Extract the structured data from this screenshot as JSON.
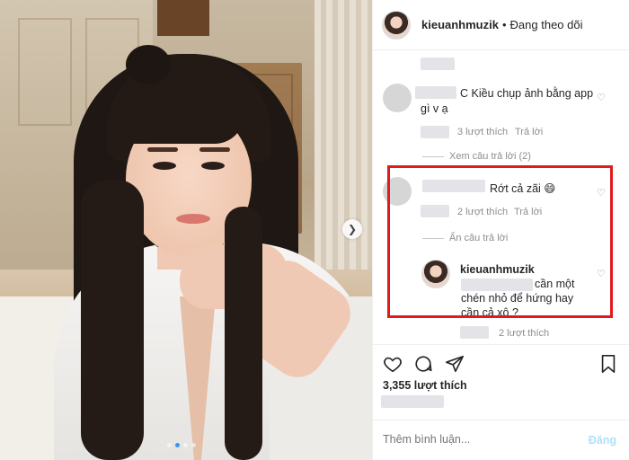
{
  "header": {
    "username": "kieuanhmuzik",
    "separator": "•",
    "follow_status": "Đang theo dõi"
  },
  "comments": [
    {
      "text_suffix": "C Kiều chụp ảnh bằng app",
      "text_line2": "gì v ạ",
      "likes": "3 lượt thích",
      "reply": "Trả lời",
      "view_replies": "Xem câu trả lời (2)"
    },
    {
      "text": "Rớt cả zãi 😄",
      "likes": "2 lượt thích",
      "reply": "Trả lời",
      "hide_replies": "Ẩn câu trả lời",
      "reply_item": {
        "username": "kieuanhmuzik",
        "text_line1": "cần một",
        "text_line2": "chén nhỏ để hứng hay",
        "text_line3": "cần cả xô ?",
        "likes": "2 lượt thích"
      }
    }
  ],
  "post": {
    "like_count": "3,355 lượt thích",
    "comment_placeholder": "Thêm bình luận...",
    "post_button": "Đăng"
  },
  "icons": {
    "next": "chevron-right-icon",
    "like": "heart-icon",
    "comment": "comment-icon",
    "share": "paper-plane-icon",
    "save": "bookmark-icon"
  },
  "colors": {
    "highlight": "#e01b1b",
    "post_button_disabled": "#b2dffc",
    "carousel_active_dot": "#3897f0"
  }
}
